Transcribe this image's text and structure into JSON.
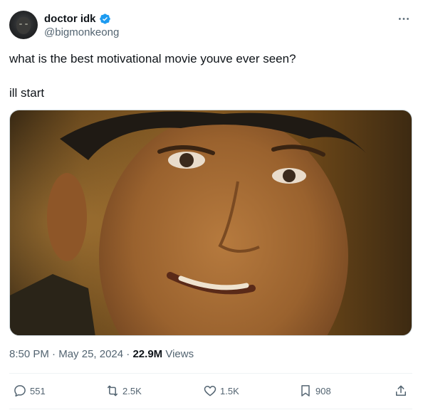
{
  "author": {
    "display_name": "doctor idk",
    "handle": "@bigmonkeong",
    "verified": true,
    "verified_color": "#1d9bf0"
  },
  "tweet": {
    "text_line1": "what is the best motivational movie youve ever seen?",
    "text_line2": "ill start"
  },
  "meta": {
    "time": "8:50 PM",
    "separator1": " · ",
    "date": "May 25, 2024",
    "separator2": " · ",
    "views_count": "22.9M",
    "views_label": " Views"
  },
  "actions": {
    "replies": "551",
    "reposts": "2.5K",
    "likes": "1.5K",
    "bookmarks": "908"
  },
  "colors": {
    "text_primary": "#0f1419",
    "text_secondary": "#536471",
    "border": "#eff3f4"
  }
}
